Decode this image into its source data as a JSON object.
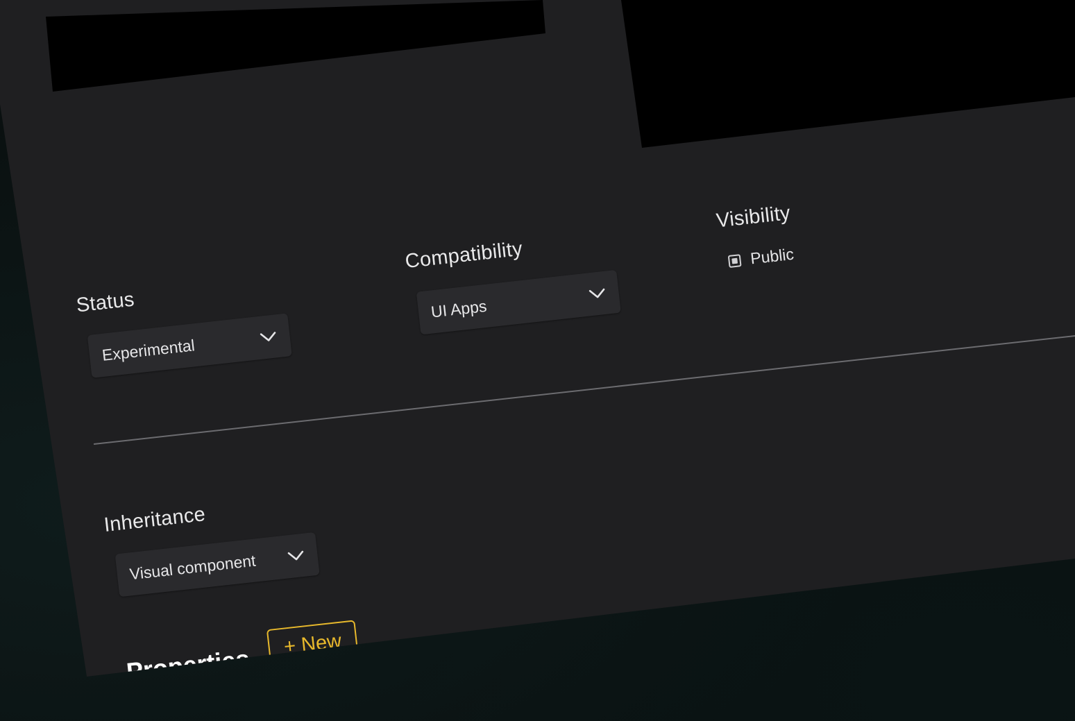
{
  "form": {
    "status": {
      "label": "Status",
      "value": "Experimental",
      "icon": "chevron-down-icon"
    },
    "compatibility": {
      "label": "Compatibility",
      "value": "UI Apps",
      "icon": "chevron-down-icon"
    },
    "visibility": {
      "label": "Visibility",
      "option_label": "Public",
      "checked": true
    },
    "inheritance": {
      "label": "Inheritance",
      "value": "Visual component",
      "icon": "chevron-down-icon"
    }
  },
  "properties": {
    "title": "Properties",
    "new_button_label": "+ New"
  },
  "colors": {
    "panel": "#1f1f21",
    "field_bg": "#2a2a2d",
    "accent": "#e8b92c",
    "text": "#e9e9ea",
    "divider": "#6c6c70"
  }
}
